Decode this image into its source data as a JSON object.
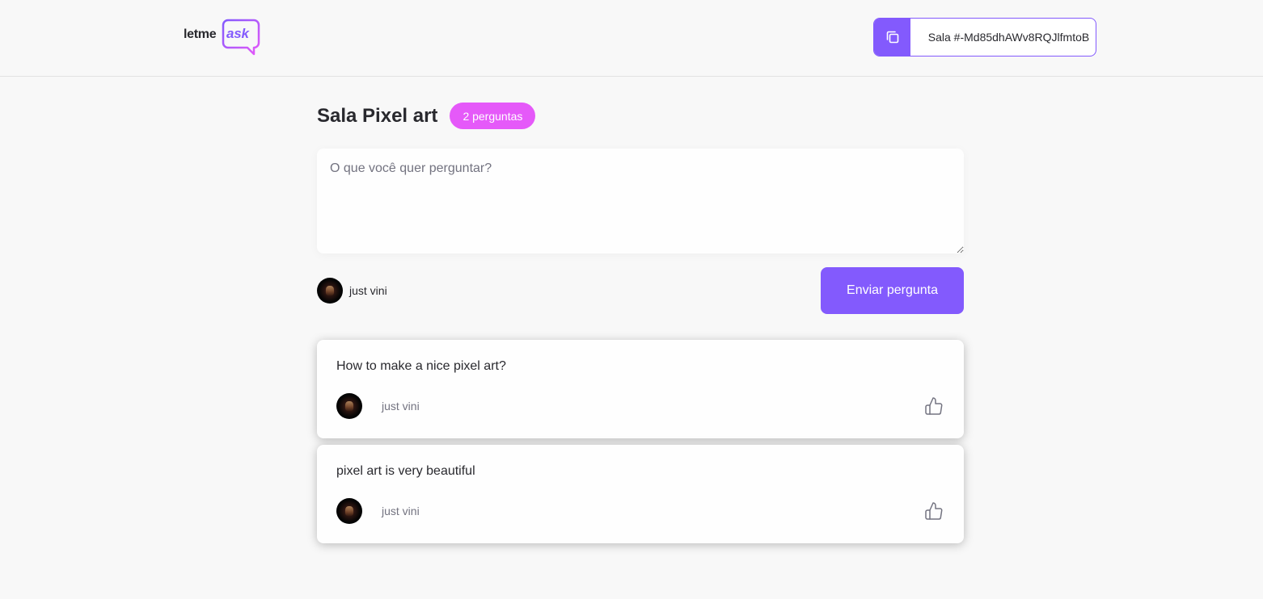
{
  "header": {
    "logo_primary": "letme",
    "logo_secondary": "ask",
    "room_code_label": "Sala #-Md85dhAWv8RQJlfmtoB"
  },
  "room": {
    "title": "Sala Pixel art",
    "question_count": "2 perguntas"
  },
  "form": {
    "placeholder": "O que você quer perguntar?",
    "value": "",
    "user_name": "just vini",
    "submit_label": "Enviar pergunta"
  },
  "questions": [
    {
      "content": "How to make a nice pixel art?",
      "author": "just vini"
    },
    {
      "content": "pixel art is very beautiful",
      "author": "just vini"
    }
  ],
  "colors": {
    "brand": "#835afd",
    "badge": "#e559f9",
    "background": "#f8f8f8",
    "text": "#29292e",
    "muted": "#737380"
  },
  "icons": {
    "copy": "copy-icon",
    "like": "thumbs-up-icon"
  }
}
